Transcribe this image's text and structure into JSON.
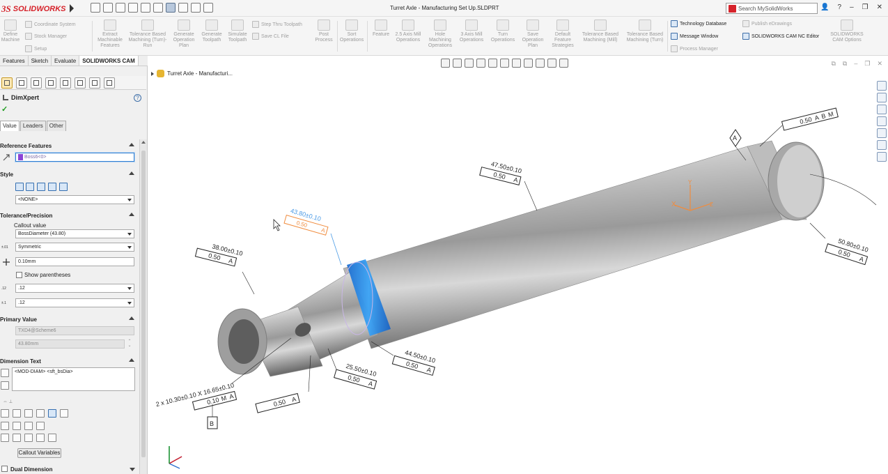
{
  "app": {
    "brand_ds": "3S",
    "brand_name": "SOLIDWORKS",
    "window_title": "Turret Axle - Manufacturing Set Up.SLDPRT",
    "search_placeholder": "Search MySolidWorks"
  },
  "ribbon": {
    "define_machine": "Define Machine",
    "coordinate_system": "Coordinate System",
    "stock_manager": "Stock Manager",
    "setup": "Setup",
    "extract_machinable_features": "Extract Machinable Features",
    "tbm_turn_run": "Tolerance Based Machining (Turn)- Run",
    "generate_operation_plan": "Generate Operation Plan",
    "generate_toolpath": "Generate Toolpath",
    "simulate_toolpath": "Simulate Toolpath",
    "step_thru_toolpath": "Step Thru Toolpath",
    "save_cl_file": "Save CL File",
    "post_process": "Post Process",
    "sort_operations": "Sort Operations",
    "feature": "Feature",
    "axis_mill_25": "2.5 Axis Mill Operations",
    "hole_machining": "Hole Machining Operations",
    "axis_mill_3": "3 Axis Mill Operations",
    "turn_operations": "Turn Operations",
    "save_operation_plan": "Save Operation Plan",
    "default_feature_strategies": "Default Feature Strategies",
    "tbm_mill": "Tolerance Based Machining (Mill)",
    "tbm_turn": "Tolerance Based Machining (Turn)",
    "technology_database": "Technology Database",
    "message_window": "Message Window",
    "process_manager": "Process Manager",
    "publish_edrawings": "Publish eDrawings",
    "cam_nc_editor": "SOLIDWORKS CAM NC Editor",
    "cam_options": "SOLIDWORKS CAM Options"
  },
  "command_tabs": [
    "Features",
    "Sketch",
    "Evaluate",
    "SOLIDWORKS CAM"
  ],
  "panel": {
    "title": "DimXpert",
    "help": "?",
    "check": "✓",
    "sub_tabs": [
      "Value",
      "Leaders",
      "Other"
    ],
    "reference_features": {
      "header": "Reference Features",
      "value": "Boss6<0>"
    },
    "style": {
      "header": "Style",
      "value": "<NONE>"
    },
    "tolerance": {
      "header": "Tolerance/Precision",
      "callout_label": "Callout value",
      "callout_value": "BossDiameter (43.80)",
      "type": "Symmetric",
      "max_variation": "0.10mm",
      "show_parentheses": "Show parentheses",
      "primary_precision": ".12",
      "tolerance_precision": ".12"
    },
    "primary_value": {
      "header": "Primary Value",
      "name": "TXD4@Scheme6",
      "value": "43.80mm"
    },
    "dimension_text": {
      "header": "Dimension Text",
      "value": "<MOD-DIAM> <sft_bsDia>"
    },
    "callout_variables": "Callout Variables",
    "dual_dimension": "Dual Dimension"
  },
  "viewport": {
    "tree_label": "Turret Axle - Manufacturi..."
  },
  "annotations": {
    "d_4380": "43.80±0.10",
    "d_4750": "47.50±0.10",
    "d_3800": "38.00±0.10",
    "d_5080": "50.80±0.10",
    "d_4450": "44.50±0.10",
    "d_2550": "25.50±0.10",
    "hole": "2 x 10.30±0.10 X 16.65±0.10",
    "tol_050m": "0.50",
    "tol_010m": "0.10",
    "mod_m": "M",
    "datum_a": "A",
    "datum_b": "B",
    "datum_b_flag": "B",
    "datum_m": "M",
    "tol_050_plain": "0.50",
    "csys_x": "X",
    "csys_y": "Y",
    "csys_z": "Z"
  },
  "colors": {
    "brand_red": "#d6222a",
    "highlight_blue": "#2e8ee8",
    "selected_annotation_orange": "#f08c3e"
  }
}
